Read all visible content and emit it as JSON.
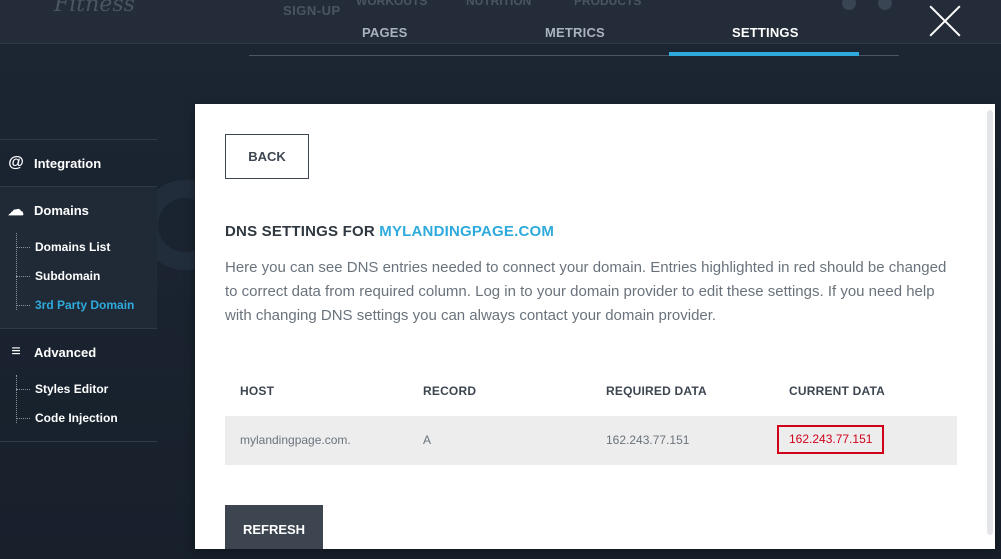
{
  "background": {
    "logo": "Fitness",
    "signup": "SIGN-UP",
    "ghost_nav": [
      "WORKOUTS",
      "NUTRITION",
      "PRODUCTS"
    ]
  },
  "tabs": [
    {
      "label": "PAGES",
      "active": false
    },
    {
      "label": "METRICS",
      "active": false
    },
    {
      "label": "SETTINGS",
      "active": true
    }
  ],
  "sidebar": {
    "groups": [
      {
        "label": "Integration",
        "icon": "at-icon",
        "glyph": "@",
        "items": []
      },
      {
        "label": "Domains",
        "icon": "cloud-upload-icon",
        "glyph": "☁",
        "active": true,
        "items": [
          {
            "label": "Domains List"
          },
          {
            "label": "Subdomain"
          },
          {
            "label": "3rd Party Domain",
            "active": true
          }
        ]
      },
      {
        "label": "Advanced",
        "icon": "settings-list-icon",
        "glyph": "≡",
        "items": [
          {
            "label": "Styles Editor"
          },
          {
            "label": "Code Injection"
          }
        ]
      }
    ]
  },
  "panel": {
    "back_label": "BACK",
    "title_prefix": "DNS SETTINGS FOR ",
    "domain": "MYLANDINGPAGE.COM",
    "description": "Here you can see DNS entries needed to connect your domain. Entries highlighted in red should be changed to correct data from required column. Log in to your domain provider to edit these settings. If you need help with changing DNS settings you can always contact your domain provider.",
    "table": {
      "headers": [
        "HOST",
        "RECORD",
        "REQUIRED DATA",
        "CURRENT DATA"
      ],
      "rows": [
        {
          "host": "mylandingpage.com.",
          "record": "A",
          "required": "162.243.77.151",
          "current": "162.243.77.151",
          "mismatch": true
        }
      ]
    },
    "refresh_label": "REFRESH"
  },
  "colors": {
    "accent": "#2eaadc",
    "error": "#d0021b",
    "dark": "#3d4650"
  }
}
